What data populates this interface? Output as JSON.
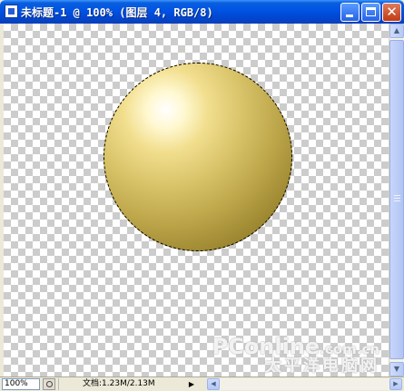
{
  "window": {
    "title": "未标题-1 @ 100% (图层 4, RGB/8)",
    "controls": {
      "close_glyph": "✕"
    }
  },
  "statusbar": {
    "zoom": "100%",
    "doc_info": "文档:1.23M/2.13M",
    "menu_arrow": "▶",
    "scroll_left": "◀",
    "scroll_right": "▶"
  },
  "scrollbar": {
    "up": "▲",
    "down": "▼"
  },
  "watermark": {
    "brand_main": "PConline",
    "brand_domain": ".com.cn",
    "brand_cn": "太平洋电脑网"
  },
  "colors": {
    "titlebar": "#0055e5",
    "sphere_highlight": "#fff8d0",
    "sphere_base": "#a08a33"
  }
}
